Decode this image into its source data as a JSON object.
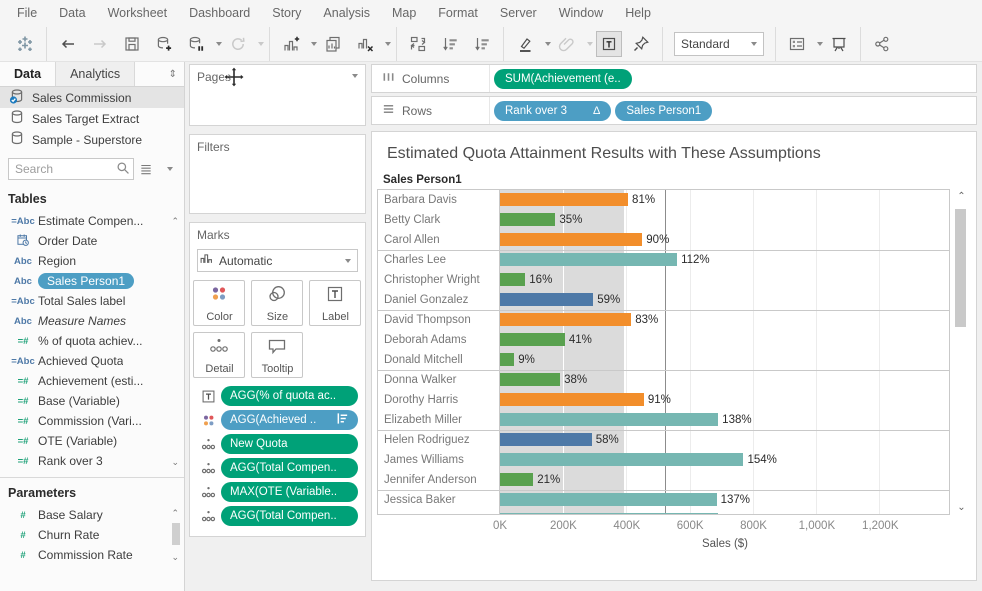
{
  "menu_items": [
    "File",
    "Data",
    "Worksheet",
    "Dashboard",
    "Story",
    "Analysis",
    "Map",
    "Format",
    "Server",
    "Window",
    "Help"
  ],
  "toolbar": {
    "fit_mode": "Standard",
    "groups": [
      {
        "items": [
          {
            "icon": "tableau-logo"
          }
        ]
      },
      {
        "items": [
          {
            "icon": "undo-arrow"
          },
          {
            "icon": "redo-arrow",
            "disabled": true
          },
          {
            "icon": "save"
          },
          {
            "icon": "new-data-source"
          },
          {
            "icon": "pause-auto-updates",
            "caret": true
          },
          {
            "icon": "run-auto-updates",
            "disabled": true,
            "caret": true
          }
        ]
      },
      {
        "items": [
          {
            "icon": "new-worksheet",
            "caret": true
          },
          {
            "icon": "duplicate-sheet"
          },
          {
            "icon": "clear-sheet",
            "caret": true
          }
        ]
      },
      {
        "items": [
          {
            "icon": "swap-rows-columns"
          },
          {
            "icon": "sort-ascending"
          },
          {
            "icon": "sort-descending"
          }
        ]
      },
      {
        "items": [
          {
            "icon": "highlight",
            "caret": true
          },
          {
            "icon": "group-members",
            "disabled": true,
            "caret": true
          },
          {
            "icon": "show-mark-labels",
            "active": true
          },
          {
            "icon": "fix-axes"
          }
        ]
      },
      {
        "items": [
          {
            "icon": "fit-selector",
            "dropdown": true
          }
        ]
      },
      {
        "items": [
          {
            "icon": "show-hide-cards",
            "caret": true
          },
          {
            "icon": "presentation-mode"
          }
        ]
      },
      {
        "items": [
          {
            "icon": "share"
          }
        ]
      }
    ]
  },
  "sidebar": {
    "tabs": [
      {
        "label": "Data",
        "active": true
      },
      {
        "label": "Analytics",
        "active": false
      }
    ],
    "tab_sort_glyph": "⇕",
    "datasources": [
      {
        "label": "Sales Commission",
        "selected": true
      },
      {
        "label": "Sales Target Extract",
        "selected": false
      },
      {
        "label": "Sample - Superstore",
        "selected": false
      }
    ],
    "search_placeholder": "Search",
    "tables_header": "Tables",
    "fields": [
      {
        "icon": "=Abc",
        "kind": "dim",
        "label": "Estimate Compen..."
      },
      {
        "icon": "date",
        "kind": "dim",
        "label": "Order Date"
      },
      {
        "icon": "Abc",
        "kind": "dim",
        "label": "Region"
      },
      {
        "icon": "Abc",
        "kind": "dim",
        "label": "Sales Person1",
        "selected": true
      },
      {
        "icon": "=Abc",
        "kind": "dim",
        "label": "Total Sales label"
      },
      {
        "icon": "Abc",
        "kind": "dim",
        "label": "Measure Names",
        "italic": true
      },
      {
        "icon": "=#",
        "kind": "meas",
        "label": "% of quota achiev..."
      },
      {
        "icon": "=Abc",
        "kind": "dim",
        "label": "Achieved Quota"
      },
      {
        "icon": "=#",
        "kind": "meas",
        "label": "Achievement (esti..."
      },
      {
        "icon": "=#",
        "kind": "meas",
        "label": "Base (Variable)"
      },
      {
        "icon": "=#",
        "kind": "meas",
        "label": "Commission (Vari..."
      },
      {
        "icon": "=#",
        "kind": "meas",
        "label": "OTE (Variable)"
      },
      {
        "icon": "=#",
        "kind": "meas",
        "label": "Rank over 3"
      }
    ],
    "parameters_header": "Parameters",
    "parameters": [
      {
        "icon": "#",
        "kind": "meas",
        "label": "Base Salary"
      },
      {
        "icon": "#",
        "kind": "meas",
        "label": "Churn Rate"
      },
      {
        "icon": "#",
        "kind": "meas",
        "label": "Commission Rate"
      }
    ]
  },
  "cards": {
    "pages_label": "Pages",
    "filters_label": "Filters",
    "marks": {
      "label": "Marks",
      "mark_type": "Automatic",
      "buttons": [
        {
          "icon": "color",
          "label": "Color"
        },
        {
          "icon": "size",
          "label": "Size"
        },
        {
          "icon": "label",
          "label": "Label"
        },
        {
          "icon": "detail",
          "label": "Detail"
        },
        {
          "icon": "tooltip",
          "label": "Tooltip"
        }
      ],
      "pills": [
        {
          "lead": "label",
          "text": "AGG(% of quota ac..",
          "color": "green"
        },
        {
          "lead": "color",
          "text": "AGG(Achieved ..",
          "color": "blue",
          "trail": "legend-bars"
        },
        {
          "lead": "detail",
          "text": "New Quota",
          "color": "green"
        },
        {
          "lead": "detail",
          "text": "AGG(Total Compen..",
          "color": "green"
        },
        {
          "lead": "detail",
          "text": "MAX(OTE (Variable..",
          "color": "green"
        },
        {
          "lead": "detail",
          "text": "AGG(Total Compen..",
          "color": "green"
        }
      ]
    }
  },
  "shelves": {
    "columns": {
      "label": "Columns",
      "pills": [
        {
          "text": "SUM(Achievement (e..",
          "color": "green"
        }
      ]
    },
    "rows": {
      "label": "Rows",
      "pills": [
        {
          "text": "Rank over 3",
          "color": "blue",
          "badge": "Δ"
        },
        {
          "text": "Sales Person1",
          "color": "blue"
        }
      ]
    }
  },
  "chart_data": {
    "type": "bar",
    "orientation": "horizontal",
    "title": "Estimated Quota Attainment Results with These Assumptions",
    "row_header": "Sales Person1",
    "xlabel": "Sales ($)",
    "x_ticks": [
      {
        "label": "0K",
        "value_k": 0
      },
      {
        "label": "200K",
        "value_k": 200
      },
      {
        "label": "400K",
        "value_k": 400
      },
      {
        "label": "600K",
        "value_k": 600
      },
      {
        "label": "800K",
        "value_k": 800
      },
      {
        "label": "1,000K",
        "value_k": 1000
      },
      {
        "label": "1,200K",
        "value_k": 1200
      }
    ],
    "xlim_k": [
      0,
      1420
    ],
    "reference_band_k": [
      0,
      392
    ],
    "reference_line_k": 523,
    "group_divider_every": 3,
    "rows": [
      {
        "name": "Barbara Davis",
        "pct_label": "81%",
        "sales_k": 405,
        "color": "orange"
      },
      {
        "name": "Betty Clark",
        "pct_label": "35%",
        "sales_k": 175,
        "color": "green"
      },
      {
        "name": "Carol Allen",
        "pct_label": "90%",
        "sales_k": 450,
        "color": "orange"
      },
      {
        "name": "Charles Lee",
        "pct_label": "112%",
        "sales_k": 560,
        "color": "teal"
      },
      {
        "name": "Christopher Wright",
        "pct_label": "16%",
        "sales_k": 80,
        "color": "green"
      },
      {
        "name": "Daniel Gonzalez",
        "pct_label": "59%",
        "sales_k": 295,
        "color": "blue"
      },
      {
        "name": "David Thompson",
        "pct_label": "83%",
        "sales_k": 415,
        "color": "orange"
      },
      {
        "name": "Deborah Adams",
        "pct_label": "41%",
        "sales_k": 205,
        "color": "green"
      },
      {
        "name": "Donald Mitchell",
        "pct_label": "9%",
        "sales_k": 45,
        "color": "green"
      },
      {
        "name": "Donna Walker",
        "pct_label": "38%",
        "sales_k": 190,
        "color": "green"
      },
      {
        "name": "Dorothy Harris",
        "pct_label": "91%",
        "sales_k": 455,
        "color": "orange"
      },
      {
        "name": "Elizabeth Miller",
        "pct_label": "138%",
        "sales_k": 690,
        "color": "teal"
      },
      {
        "name": "Helen Rodriguez",
        "pct_label": "58%",
        "sales_k": 290,
        "color": "blue"
      },
      {
        "name": "James Williams",
        "pct_label": "154%",
        "sales_k": 770,
        "color": "teal"
      },
      {
        "name": "Jennifer Anderson",
        "pct_label": "21%",
        "sales_k": 105,
        "color": "green"
      },
      {
        "name": "Jessica Baker",
        "pct_label": "137%",
        "sales_k": 685,
        "color": "teal"
      }
    ],
    "partial_row": {
      "sales_k": 690,
      "color": "teal"
    },
    "colors": {
      "orange": "#f28e2b",
      "green": "#59a14f",
      "blue": "#4e79a7",
      "teal": "#76b7b2",
      "band": "#dbdbdb",
      "reference_line": "#8c8c8c",
      "pill_green": "#00a178",
      "pill_blue": "#4d9ec4"
    }
  }
}
